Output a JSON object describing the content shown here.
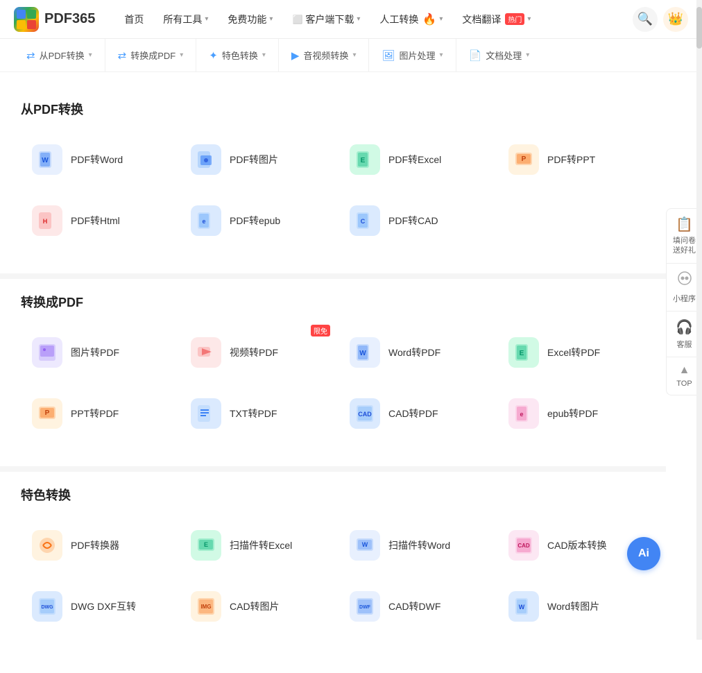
{
  "logo": {
    "text": "PDF365"
  },
  "topNav": {
    "items": [
      {
        "label": "首页",
        "hasDropdown": false
      },
      {
        "label": "所有工具",
        "hasDropdown": true
      },
      {
        "label": "免费功能",
        "hasDropdown": true
      },
      {
        "label": "客户端下载",
        "hasDropdown": true,
        "hasIcon": true
      },
      {
        "label": "人工转换",
        "hasDropdown": true,
        "hasFire": true
      },
      {
        "label": "文档翻译",
        "hasDropdown": true,
        "hasBadge": true,
        "badge": "热门"
      }
    ],
    "searchLabel": "🔍",
    "crownLabel": "👑"
  },
  "subNav": {
    "items": [
      {
        "label": "从PDF转换",
        "hasDropdown": true
      },
      {
        "label": "转换成PDF",
        "hasDropdown": true
      },
      {
        "label": "特色转换",
        "hasDropdown": true
      },
      {
        "label": "音视频转换",
        "hasDropdown": true
      },
      {
        "label": "图片处理",
        "hasDropdown": true
      },
      {
        "label": "文档处理",
        "hasDropdown": true
      }
    ]
  },
  "sections": [
    {
      "id": "from-pdf",
      "title": "从PDF转换",
      "tools": [
        {
          "label": "PDF转Word",
          "iconColor": "icon-blue-light",
          "iconChar": "📄",
          "iconBg": "#dbeafe",
          "iconText": "W"
        },
        {
          "label": "PDF转图片",
          "iconColor": "icon-blue",
          "iconChar": "🖼",
          "iconBg": "#dbeafe",
          "iconText": "IMG"
        },
        {
          "label": "PDF转Excel",
          "iconColor": "icon-green",
          "iconChar": "📊",
          "iconBg": "#d1fae5",
          "iconText": "E"
        },
        {
          "label": "PDF转PPT",
          "iconColor": "icon-orange",
          "iconChar": "📑",
          "iconBg": "#fff3e0",
          "iconText": "P"
        },
        {
          "label": "PDF转Html",
          "iconColor": "icon-red",
          "iconChar": "🌐",
          "iconBg": "#fde8e8",
          "iconText": "H"
        },
        {
          "label": "PDF转epub",
          "iconColor": "icon-blue",
          "iconChar": "📖",
          "iconBg": "#dbeafe",
          "iconText": "E"
        },
        {
          "label": "PDF转CAD",
          "iconColor": "icon-blue",
          "iconChar": "📐",
          "iconBg": "#dbeafe",
          "iconText": "C"
        }
      ]
    },
    {
      "id": "to-pdf",
      "title": "转换成PDF",
      "tools": [
        {
          "label": "图片转PDF",
          "iconColor": "icon-purple",
          "iconBg": "#ede9fe",
          "iconText": "IMG"
        },
        {
          "label": "视频转PDF",
          "iconColor": "icon-red",
          "iconBg": "#fde8e8",
          "iconText": "▶",
          "badge": "限免"
        },
        {
          "label": "Word转PDF",
          "iconColor": "icon-blue-light",
          "iconBg": "#dbeafe",
          "iconText": "W"
        },
        {
          "label": "Excel转PDF",
          "iconColor": "icon-green",
          "iconBg": "#d1fae5",
          "iconText": "E"
        },
        {
          "label": "PPT转PDF",
          "iconColor": "icon-orange",
          "iconBg": "#fff3e0",
          "iconText": "P"
        },
        {
          "label": "TXT转PDF",
          "iconColor": "icon-blue",
          "iconBg": "#dbeafe",
          "iconText": "T"
        },
        {
          "label": "CAD转PDF",
          "iconColor": "icon-blue",
          "iconBg": "#dbeafe",
          "iconText": "C"
        },
        {
          "label": "epub转PDF",
          "iconColor": "icon-pink",
          "iconBg": "#fce7f3",
          "iconText": "E"
        }
      ]
    },
    {
      "id": "special",
      "title": "特色转换",
      "tools": [
        {
          "label": "PDF转换器",
          "iconColor": "icon-orange",
          "iconBg": "#fff3e0",
          "iconText": "⚙"
        },
        {
          "label": "扫描件转Excel",
          "iconColor": "icon-green",
          "iconBg": "#d1fae5",
          "iconText": "E"
        },
        {
          "label": "扫描件转Word",
          "iconColor": "icon-blue-light",
          "iconBg": "#dbeafe",
          "iconText": "W"
        },
        {
          "label": "CAD版本转换",
          "iconColor": "icon-pink",
          "iconBg": "#fce7f3",
          "iconText": "C"
        },
        {
          "label": "DWG DXF互转",
          "iconColor": "icon-blue",
          "iconBg": "#dbeafe",
          "iconText": "D"
        },
        {
          "label": "CAD转图片",
          "iconColor": "icon-orange",
          "iconBg": "#fff3e0",
          "iconText": "C"
        },
        {
          "label": "CAD转DWF",
          "iconColor": "icon-blue-light",
          "iconBg": "#dbeafe",
          "iconText": "C"
        },
        {
          "label": "Word转图片",
          "iconColor": "icon-blue",
          "iconBg": "#dbeafe",
          "iconText": "W"
        }
      ]
    }
  ],
  "rightPanel": {
    "items": [
      {
        "label": "填问卷\n送好礼",
        "icon": "📋"
      },
      {
        "label": "小程序",
        "icon": "⚙"
      },
      {
        "label": "客服",
        "icon": "🎧"
      },
      {
        "label": "TOP",
        "icon": "▲"
      }
    ]
  },
  "aiBtn": {
    "label": "Ai"
  }
}
